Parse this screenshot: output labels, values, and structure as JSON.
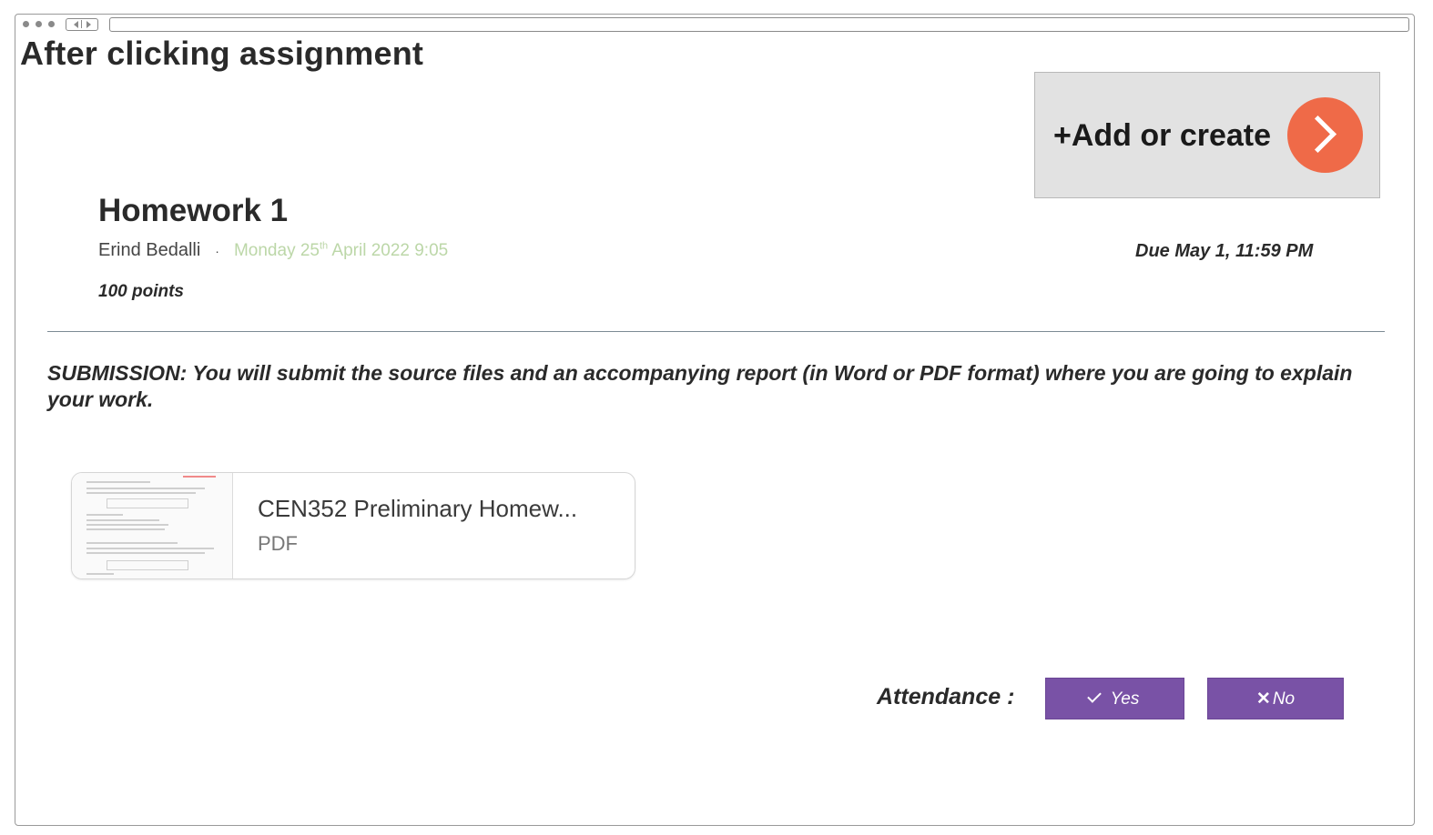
{
  "page": {
    "heading": "After clicking assignment"
  },
  "add_button": {
    "label": "+Add or create",
    "icon": "chevron-right-icon",
    "accent_color": "#ef6a48"
  },
  "assignment": {
    "title": "Homework 1",
    "author": "Erind Bedalli",
    "separator": "·",
    "posted_date_prefix": "Monday 25",
    "posted_date_sup": "th",
    "posted_date_suffix": " April 2022 9:05",
    "due": "Due May 1, 11:59 PM",
    "points": "100 points",
    "description": "SUBMISSION: You will submit the source files and an accompanying report (in Word or PDF format) where you are going to explain your work."
  },
  "attachment": {
    "name": "CEN352 Preliminary Homew...",
    "type": "PDF"
  },
  "attendance": {
    "label": "Attendance :",
    "yes_label": "Yes",
    "no_label": "No",
    "yes_icon": "check-icon",
    "no_icon": "x-icon",
    "button_color": "#7952a6"
  }
}
